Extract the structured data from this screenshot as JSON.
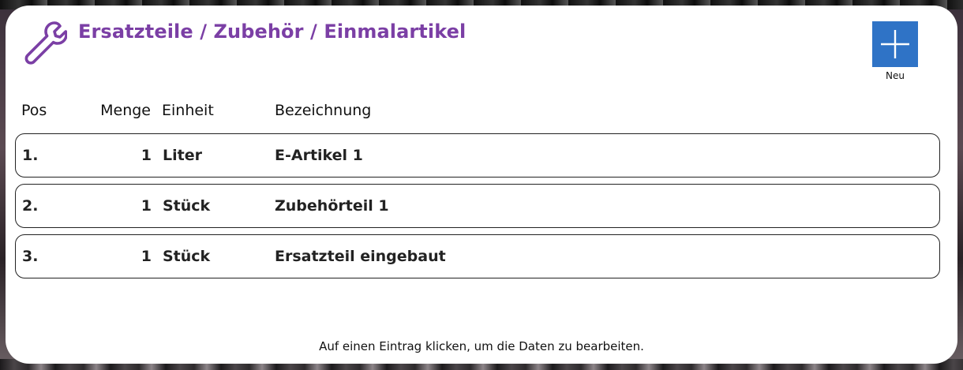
{
  "header": {
    "icon": "wrench-icon",
    "title": "Ersatzteile / Zubehör / Einmalartikel",
    "title_color": "#7b3fa5"
  },
  "new_button": {
    "icon": "plus-icon",
    "label": "Neu",
    "color": "#2f73c6"
  },
  "columns": {
    "pos": "Pos",
    "qty": "Menge",
    "unit": "Einheit",
    "desc": "Bezeichnung"
  },
  "rows": [
    {
      "pos": "1.",
      "qty": "1",
      "unit": "Liter",
      "desc": "E-Artikel 1"
    },
    {
      "pos": "2.",
      "qty": "1",
      "unit": "Stück",
      "desc": "Zubehörteil 1"
    },
    {
      "pos": "3.",
      "qty": "1",
      "unit": "Stück",
      "desc": "Ersatzteil eingebaut"
    }
  ],
  "footer": {
    "hint": "Auf einen Eintrag klicken, um die Daten zu bearbeiten."
  }
}
